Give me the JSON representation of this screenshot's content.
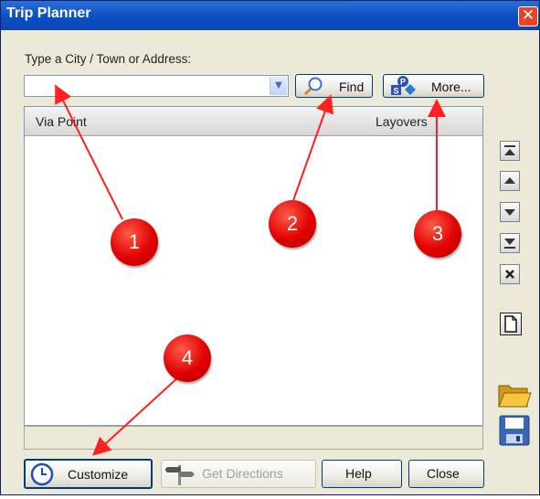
{
  "window": {
    "title": "Trip Planner",
    "close_glyph": "✕"
  },
  "search": {
    "label": "Type a City / Town or Address:",
    "value": "",
    "placeholder": ""
  },
  "buttons": {
    "find": "Find",
    "more": "More...",
    "customize": "Customize",
    "get_directions": "Get Directions",
    "help": "Help",
    "close": "Close"
  },
  "list": {
    "columns": [
      "Via Point",
      "Layovers"
    ],
    "rows": []
  },
  "side_toolbar": [
    "move-to-top-icon",
    "move-up-icon",
    "move-down-icon",
    "move-to-bottom-icon",
    "delete-icon",
    "new-document-icon",
    "open-folder-icon",
    "save-icon"
  ],
  "callouts": [
    "1",
    "2",
    "3",
    "4"
  ],
  "colors": {
    "titlebar": "#0b4fc4",
    "callout": "#e00000",
    "arrow": "#ff2020"
  }
}
